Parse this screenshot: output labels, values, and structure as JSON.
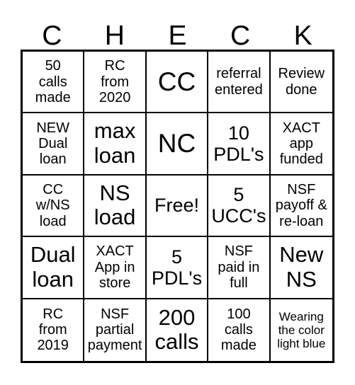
{
  "header": {
    "letters": [
      "C",
      "H",
      "E",
      "C",
      "K"
    ]
  },
  "grid": {
    "rows": 5,
    "columns": 5,
    "border_color": "#000000",
    "background_color": "#ffffff",
    "text_color": "#000000",
    "cells": [
      {
        "text": "50\ncalls\nmade",
        "size": "md"
      },
      {
        "text": "RC\nfrom\n2020",
        "size": "md"
      },
      {
        "text": "CC",
        "size": "xxl"
      },
      {
        "text": "referral\nentered",
        "size": "md"
      },
      {
        "text": "Review\ndone",
        "size": "md"
      },
      {
        "text": "NEW\nDual\nloan",
        "size": "md"
      },
      {
        "text": "max\nloan",
        "size": "xl"
      },
      {
        "text": "NC",
        "size": "xxl"
      },
      {
        "text": "10\nPDL's",
        "size": "lg"
      },
      {
        "text": "XACT\napp\nfunded",
        "size": "md"
      },
      {
        "text": "CC\nw/NS\nload",
        "size": "md"
      },
      {
        "text": "NS\nload",
        "size": "xl"
      },
      {
        "text": "Free!",
        "size": "lg"
      },
      {
        "text": "5\nUCC's",
        "size": "lg"
      },
      {
        "text": "NSF\npayoff &\nre-loan",
        "size": "md"
      },
      {
        "text": "Dual\nloan",
        "size": "xl"
      },
      {
        "text": "XACT\nApp in\nstore",
        "size": "md"
      },
      {
        "text": "5\nPDL's",
        "size": "lg"
      },
      {
        "text": "NSF\npaid in\nfull",
        "size": "md"
      },
      {
        "text": "New\nNS",
        "size": "xl"
      },
      {
        "text": "RC\nfrom\n2019",
        "size": "md"
      },
      {
        "text": "NSF\npartial\npayment",
        "size": "md"
      },
      {
        "text": "200\ncalls",
        "size": "xl"
      },
      {
        "text": "100\ncalls\nmade",
        "size": "md"
      },
      {
        "text": "Wearing\nthe color\nlight blue",
        "size": "sm"
      }
    ]
  }
}
